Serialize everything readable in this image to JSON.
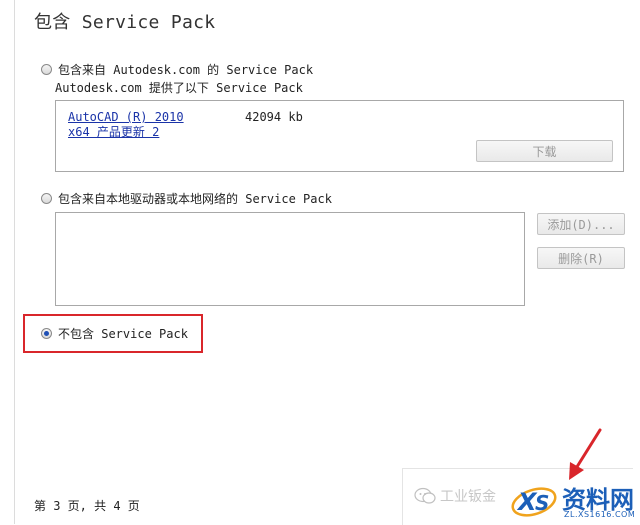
{
  "title": "包含 Service Pack",
  "option_online": {
    "label": "包含来自 Autodesk.com 的 Service Pack",
    "subtext": "Autodesk.com 提供了以下 Service Pack",
    "item_link_line1": "AutoCAD (R) 2010",
    "item_link_line2": "x64 产品更新 2",
    "item_size": "42094 kb",
    "download_label": "下载"
  },
  "option_local": {
    "label": "包含来自本地驱动器或本地网络的 Service Pack",
    "add_label": "添加(D)...",
    "remove_label": "删除(R)"
  },
  "option_none": {
    "label": "不包含 Service Pack",
    "selected": true
  },
  "footer": {
    "page_info": "第 3 页, 共 4 页",
    "watermark_text": "工业钣金",
    "logo_text": "资料网",
    "logo_sub": "ZL.XS1616.COM"
  },
  "colors": {
    "highlight": "#d9262b",
    "link": "#1a33a8",
    "logo": "#1c5fb8"
  }
}
